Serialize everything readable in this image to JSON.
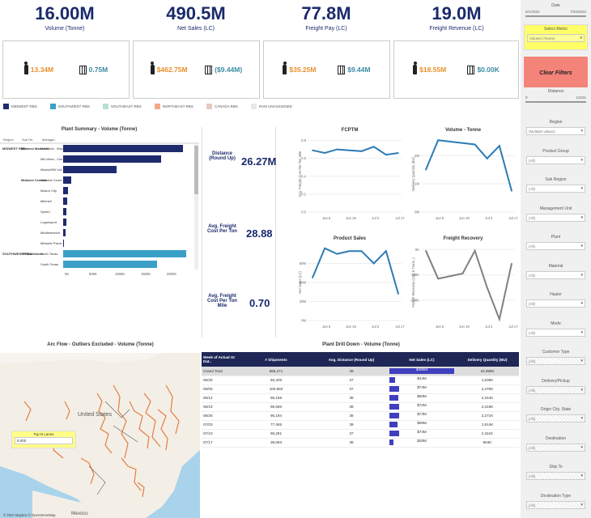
{
  "kpis": [
    {
      "value": "16.00M",
      "label": "Volume (Tonne)"
    },
    {
      "value": "490.5M",
      "label": "Net Sales (LC)"
    },
    {
      "value": "77.8M",
      "label": "Freight Pay (LC)"
    },
    {
      "value": "19.0M",
      "label": "Freight Revenue (LC)"
    }
  ],
  "kpi_boxes": [
    {
      "left": "13.34M",
      "right": "0.75M"
    },
    {
      "left": "$462.75M",
      "right": "($9.44M)"
    },
    {
      "left": "$35.25M",
      "right": "$9.44M"
    },
    {
      "left": "$18.55M",
      "right": "$0.00K"
    }
  ],
  "legend": [
    {
      "label": "MIDWEST RBS",
      "color": "#1e2b6e"
    },
    {
      "label": "SOUTHWEST RBS",
      "color": "#3aa0c8"
    },
    {
      "label": "SOUTHEAST RBS",
      "color": "#b8e0d6"
    },
    {
      "label": "NORTHEAST RBS",
      "color": "#f4a88a"
    },
    {
      "label": "CANADA RBS",
      "color": "#e8c8c0"
    },
    {
      "label": "RAM UNASSIGNED",
      "color": "#e8e8e8"
    }
  ],
  "plant_summary": {
    "title": "Plant Summary - Volume (Tonne)",
    "col_headers": [
      "Region",
      "Sub Re..",
      "Manager.."
    ],
    "regions": [
      {
        "region": "MIDWEST RBS",
        "sub": "Midwest Materials",
        "manager": "Mid West - Mac.."
      },
      {
        "sub": "",
        "manager": "Mid West - Cen.."
      },
      {
        "sub": "",
        "manager": "Illinois/MW Ind.."
      },
      {
        "sub": "Midwest Cement",
        "manager": "Midwest Ceme.."
      },
      {
        "sub": "",
        "manager": "Mason City"
      },
      {
        "sub": "",
        "manager": "Mitchell"
      },
      {
        "sub": "",
        "manager": "Speed"
      },
      {
        "sub": "",
        "manager": "Logansport"
      },
      {
        "sub": "",
        "manager": "Middlebranch"
      },
      {
        "sub": "",
        "manager": "Midwest Parch.."
      },
      {
        "region": "SOUTHWES T RBS",
        "sub": "SR Southwest",
        "manager": "North Texas"
      },
      {
        "sub": "",
        "manager": "South Texas"
      }
    ],
    "x_ticks": [
      "0K",
      "500K",
      "1000K",
      "1500K",
      "2000K"
    ]
  },
  "metrics": [
    {
      "label": "Distance (Round Up)",
      "value": "26.27M"
    },
    {
      "label": "Avg. Freight Cost Per Ton",
      "value": "28.88"
    },
    {
      "label": "Avg. Freight Cost Per Ton Mile",
      "value": "0.70"
    }
  ],
  "chart_data": [
    {
      "type": "line",
      "title": "FCPTM",
      "ylabel": "Avg. Freight Cost Per Ton Mile",
      "x_ticks": [
        "Jun 5",
        "Jun 19",
        "Jul 3",
        "Jul 17"
      ],
      "y_ticks": [
        "0.0",
        "0.2",
        "0.4",
        "0.6",
        "0.8"
      ],
      "ylim": [
        0,
        0.85
      ],
      "values": [
        0.69,
        0.66,
        0.7,
        0.69,
        0.68,
        0.73,
        0.64,
        0.66
      ]
    },
    {
      "type": "line",
      "title": "Volume - Tonne",
      "ylabel": "Delivery Quantity (BU)",
      "x_ticks": [
        "Jun 5",
        "Jun 19",
        "Jul 3",
        "Jul 17"
      ],
      "y_ticks": [
        "0M",
        "1M",
        "2M"
      ],
      "ylim": [
        0,
        2.7
      ],
      "values": [
        1.5,
        2.55,
        2.5,
        2.45,
        2.4,
        1.9,
        2.35,
        0.75
      ]
    },
    {
      "type": "line",
      "title": "Product Sales",
      "ylabel": "Net Sales (LC)",
      "x_ticks": [
        "Jun 5",
        "Jun 19",
        "Jul 3",
        "Jul 17"
      ],
      "y_ticks": [
        "0M",
        "20M",
        "40M",
        "60M"
      ],
      "ylim": [
        0,
        80
      ],
      "values": [
        45,
        76,
        70,
        73,
        73,
        60,
        73,
        28
      ]
    },
    {
      "type": "line",
      "title": "Freight Recovery",
      "ylabel": "Freight Recovery (Agg & Trans..)",
      "x_ticks": [
        "Jun 5",
        "Jun 19",
        "Jul 3",
        "Jul 17"
      ],
      "y_ticks": [
        "0K",
        "-100K",
        "-200K"
      ],
      "ylim": [
        -280,
        20
      ],
      "values": [
        -5,
        -115,
        -105,
        -95,
        -5,
        -150,
        -275,
        -55
      ]
    }
  ],
  "arc_flow": {
    "title": "Arc Flow - Outliers Excluded - Volume (Tonne)",
    "map_label_country": "United States",
    "map_label_mexico": "Mexico",
    "topn_label": "Top N Lanes",
    "topn_value": "5,000",
    "attribution": "© 2022 Mapbox © OpenStreetMap"
  },
  "drill": {
    "title": "Plant Drill Down - Volume (Tonne)",
    "headers": [
      "Week of Actual GI Dat..",
      "# Shipments",
      "Avg. Distance (Round Up)",
      "Net Sales (LC)",
      "Delivery Quantity (BU)"
    ],
    "rows": [
      {
        "week": "Grand Total",
        "ship": "665,271",
        "dist": "39",
        "sales": "$490M",
        "qty": "15,998K",
        "frac": 1.0
      },
      {
        "week": "05/29",
        "ship": "65,339",
        "dist": "37",
        "sales": "$44M",
        "qty": "1,536K",
        "frac": 0.09
      },
      {
        "week": "06/05",
        "ship": "100,682",
        "dist": "37",
        "sales": "$73M",
        "qty": "2,376K",
        "frac": 0.15
      },
      {
        "week": "06/12",
        "ship": "98,159",
        "dist": "38",
        "sales": "$69M",
        "qty": "2,344K",
        "frac": 0.14
      },
      {
        "week": "06/19",
        "ship": "95,696",
        "dist": "38",
        "sales": "$72M",
        "qty": "2,319K",
        "frac": 0.15
      },
      {
        "week": "06/26",
        "ship": "95,194",
        "dist": "38",
        "sales": "$73M",
        "qty": "2,271K",
        "frac": 0.15
      },
      {
        "week": "07/03",
        "ship": "77,455",
        "dist": "39",
        "sales": "$59M",
        "qty": "1,914K",
        "frac": 0.12
      },
      {
        "week": "07/10",
        "ship": "98,291",
        "dist": "37",
        "sales": "$73M",
        "qty": "2,311K",
        "frac": 0.15
      },
      {
        "week": "07/17",
        "ship": "38,083",
        "dist": "38",
        "sales": "$28M",
        "qty": "904K",
        "frac": 0.06
      }
    ]
  },
  "sidebar": {
    "date_label": "Date",
    "date_from": "5/1/2022",
    "date_to": "7/20/2022",
    "select_metric_label": "Select Metric",
    "select_metric_value": "Volume (Tonne)",
    "clear_filters": "Clear Filters",
    "distance_label": "Distance",
    "distance_min": "0",
    "distance_max": "12231",
    "filters": [
      {
        "label": "Region",
        "value": "(Multiple values)"
      },
      {
        "label": "Product Group",
        "value": "(All)"
      },
      {
        "label": "Sub Region",
        "value": "(All)"
      },
      {
        "label": "Management Unit",
        "value": "(All)"
      },
      {
        "label": "Plant",
        "value": "(All)"
      },
      {
        "label": "Material",
        "value": "(All)"
      },
      {
        "label": "Hauler",
        "value": "(All)"
      },
      {
        "label": "Mode",
        "value": "(All)"
      },
      {
        "label": "Customer Type",
        "value": "(All)"
      },
      {
        "label": "Delivery/Pickup",
        "value": "(All)"
      },
      {
        "label": "Origin City, State",
        "value": "(All)"
      },
      {
        "label": "Destination",
        "value": "(All)"
      },
      {
        "label": "Ship To",
        "value": "(All)"
      },
      {
        "label": "Destination Type",
        "value": "(All)"
      }
    ]
  }
}
